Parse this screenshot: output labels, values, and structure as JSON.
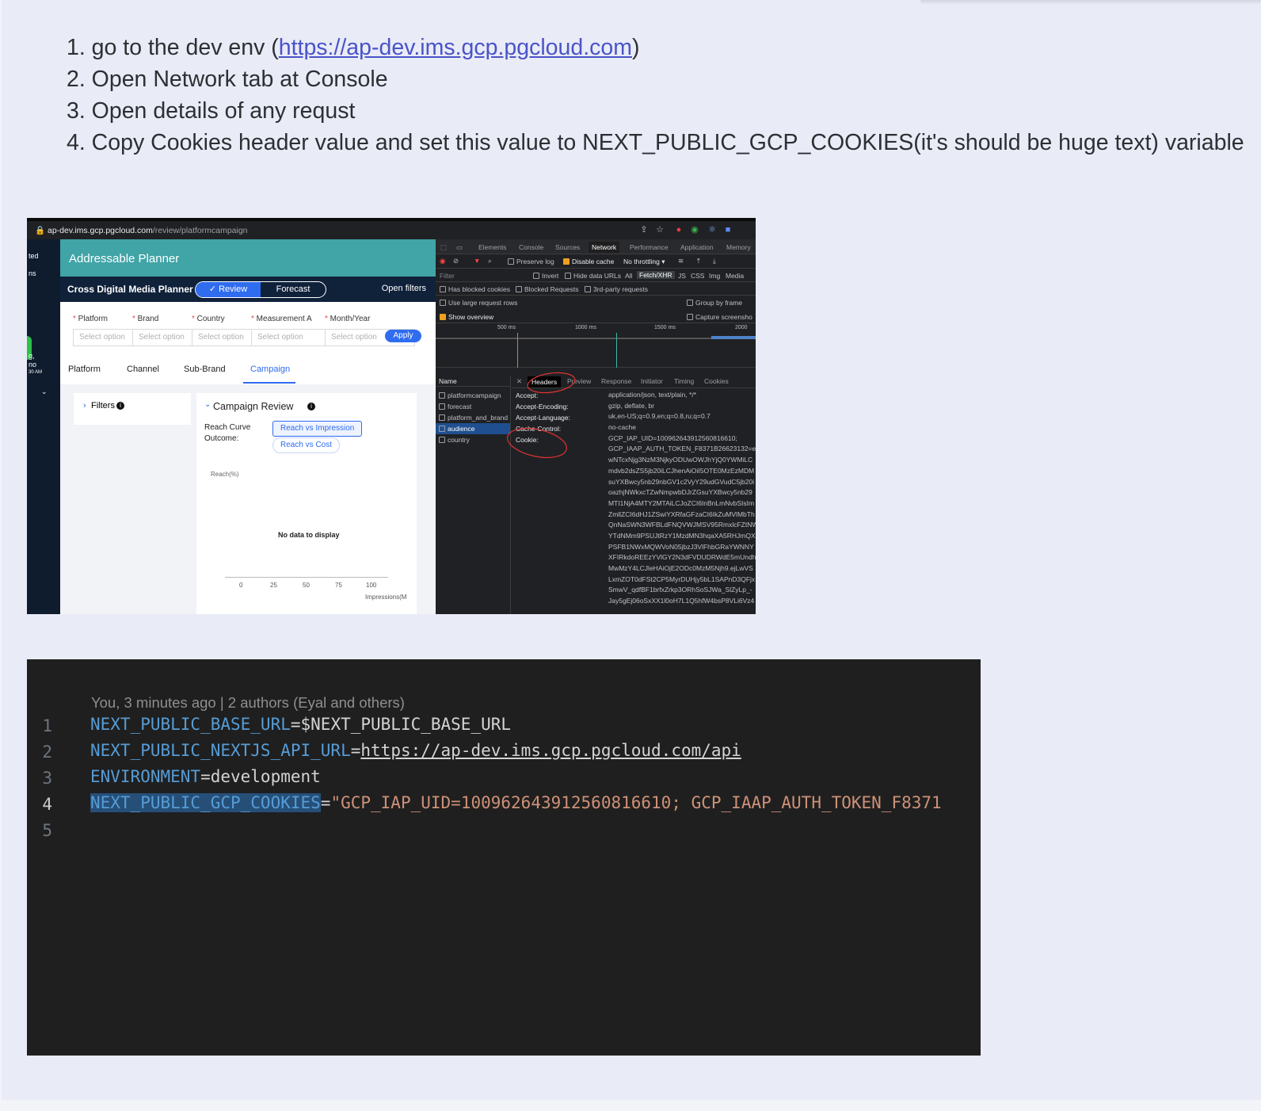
{
  "instructions": {
    "step1_prefix": "1. go to the dev env (",
    "step1_link": "https://ap-dev.ims.gcp.pgcloud.com",
    "step1_suffix": ")",
    "step2": "2. Open Network tab at Console",
    "step3": "3. Open details of any requst",
    "step4": "4. Copy Cookies header value and set this value to NEXT_PUBLIC_GCP_COOKIES(it's should be huge text) variable"
  },
  "screenshot": {
    "browser": {
      "url_host": "ap-dev.ims.gcp.pgcloud.com",
      "url_path": "/review/platformcampaign"
    },
    "left_sidebar": [
      "ted",
      "ns",
      "g,",
      "no",
      "30 AM"
    ],
    "app": {
      "title": "Addressable Planner",
      "subtitle": "Cross Digital Media Planner",
      "mode_review": "✓ Review",
      "mode_forecast": "Forecast",
      "open_filters": "Open filters",
      "filters": [
        {
          "label": "Platform",
          "placeholder": "Select option"
        },
        {
          "label": "Brand",
          "placeholder": "Select option"
        },
        {
          "label": "Country",
          "placeholder": "Select option"
        },
        {
          "label": "Measurement A",
          "placeholder": "Select option"
        },
        {
          "label": "Month/Year",
          "placeholder": "Select option"
        }
      ],
      "apply": "Apply",
      "tabs": [
        "Platform",
        "Channel",
        "Sub-Brand",
        "Campaign"
      ],
      "active_tab": "Campaign",
      "filters_panel": "Filters",
      "campaign_review": "Campaign Review",
      "reach_curve": "Reach Curve",
      "outcome": "Outcome:",
      "reach_vs_impression": "Reach vs Impression",
      "reach_vs_cost": "Reach vs Cost",
      "y_axis": "Reach(%)",
      "no_data": "No data to display",
      "x_ticks": [
        "0",
        "25",
        "50",
        "75",
        "100"
      ],
      "x_axis": "Impressions(M"
    },
    "devtools": {
      "tabs": [
        "Elements",
        "Console",
        "Sources",
        "Network",
        "Performance",
        "Application",
        "Memory"
      ],
      "active_tab": "Network",
      "preserve_log": "Preserve log",
      "disable_cache": "Disable cache",
      "throttling": "No throttling",
      "filter_placeholder": "Filter",
      "invert": "Invert",
      "hide_data_urls": "Hide data URLs",
      "type_filters": [
        "All",
        "Fetch/XHR",
        "JS",
        "CSS",
        "Img",
        "Media"
      ],
      "has_blocked_cookies": "Has blocked cookies",
      "blocked_requests": "Blocked Requests",
      "third_party": "3rd-party requests",
      "large_rows": "Use large request rows",
      "group_by_frame": "Group by frame",
      "show_overview": "Show overview",
      "capture_screenshots": "Capture screensho",
      "timeline": [
        "500 ms",
        "1000 ms",
        "1500 ms",
        "2000"
      ],
      "name_header": "Name",
      "requests": [
        "platformcampaign",
        "forecast",
        "platform_and_brand",
        "audience",
        "country"
      ],
      "selected_request": "audience",
      "detail_tabs": [
        "Headers",
        "Preview",
        "Response",
        "Initiator",
        "Timing",
        "Cookies"
      ],
      "header_keys": [
        "Accept:",
        "Accept-Encoding:",
        "Accept-Language:",
        "Cache-Control:",
        "Cookie:"
      ],
      "header_values": [
        "application/json, text/plain, */*",
        "gzip, deflate, br",
        "uk,en-US;q=0.9,en;q=0.8,ru;q=0.7",
        "no-cache",
        "GCP_IAP_UID=100962643912560816610;",
        "GCP_IAAP_AUTH_TOKEN_F8371B26623132=ey",
        "wNTcxNjg3NzM3NjkyODUwOWJhYjQ0YWMiLC",
        "mdvb2dsZS5jb20iLCJhenAiOiI5OTE0MzEzMDM",
        "suYXBwcy5nb29nbGV1c2VyY29udGVudC5jb20i",
        "oazhjNWkxcTZwNmpwbDJrZGsuYXBwcy5nb29",
        "MTI1NjA4MTY2MTAiLCJoZCI6InBnLmNvbSIsIm",
        "ZmllZCI6dHJ1ZSwiYXRfaGFzaCI6IkZuMVlMbTh",
        "QnNaSWN3WFBLdFNQVWJMSV95RmxlcFZtNW",
        "YTdNMm9PSUJtRzY1MzdMN3hqaXA5RHJmQX",
        "PSFB1NWxMQWVoN05jbzJ3VlFhbGRaYWNNY",
        "XFIRkdoREEzYVlGY2N3dFVDUDRWdE5mUndh",
        "MwMzY4LCJleHAiOjE2ODc0MzM5Njh9.ejLwVS",
        "LxmZOT0dFSt2CP5MyrDUHjy5bL1SAPnD3QFjx",
        "SmwV_qdfBF1brfxZrkp3ORhSoSJWa_SlZyLp_-",
        "Jay5gEj06oSxXX1l0oH7L1Q5hfW4bsP8VLi6Vz4"
      ]
    }
  },
  "editor": {
    "blame": "You, 3 minutes ago | 2 authors (Eyal and others)",
    "line_numbers": [
      "1",
      "2",
      "3",
      "4",
      "5"
    ],
    "line1_key": "NEXT_PUBLIC_BASE_URL",
    "line1_val": "=$NEXT_PUBLIC_BASE_URL",
    "line2_key": "NEXT_PUBLIC_NEXTJS_API_URL",
    "line2_eq": "=",
    "line2_val": "https://ap-dev.ims.gcp.pgcloud.com/api",
    "line3_key": "ENVIRONMENT",
    "line3_val": "=development",
    "line4_key": "NEXT_PUBLIC_GCP_COOKIES",
    "line4_eq": "=",
    "line4_val": "\"GCP_IAP_UID=100962643912560816610; GCP_IAAP_AUTH_TOKEN_F8371"
  }
}
